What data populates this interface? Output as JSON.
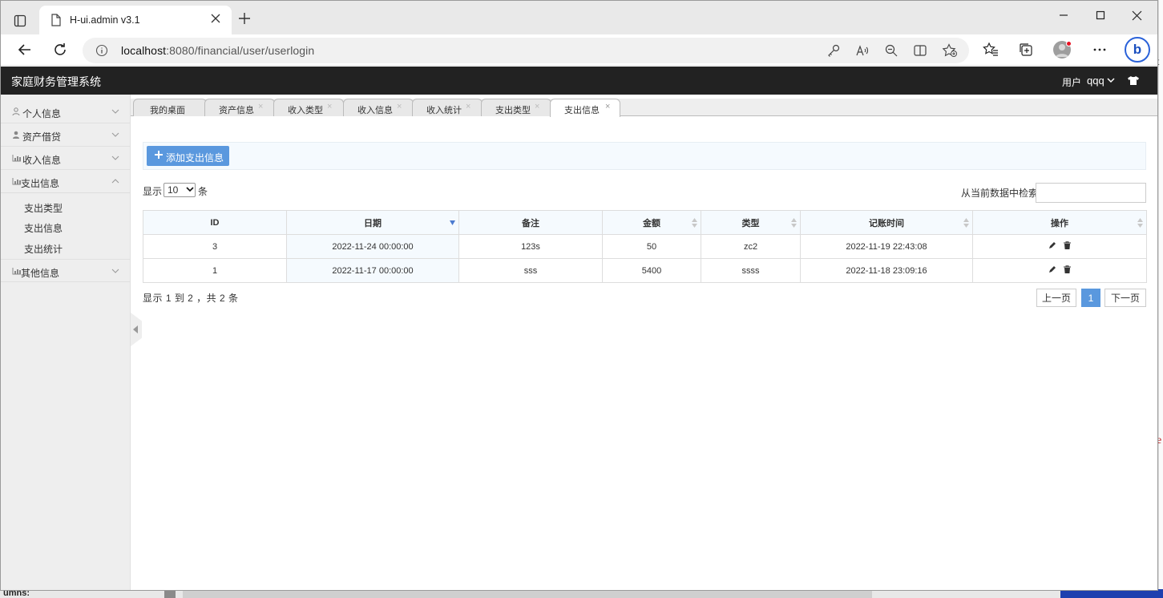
{
  "browser": {
    "tab_title": "H-ui.admin v3.1",
    "url_host": "localhost",
    "url_rest": ":8080/financial/user/userlogin"
  },
  "app": {
    "title": "家庭财务管理系统",
    "user_label": "用户",
    "user_name": "qqq"
  },
  "sidebar": {
    "menus": [
      {
        "label": "个人信息",
        "icon": "user-outline-icon"
      },
      {
        "label": "资产借贷",
        "icon": "user-icon"
      },
      {
        "label": "收入信息",
        "icon": "chart-icon"
      },
      {
        "label": "支出信息",
        "icon": "chart-icon"
      },
      {
        "label": "其他信息",
        "icon": "chart-icon"
      }
    ],
    "submenu": [
      "支出类型",
      "支出信息",
      "支出统计"
    ]
  },
  "tabs": [
    "我的桌面",
    "资产信息",
    "收入类型",
    "收入信息",
    "收入统计",
    "支出类型",
    "支出信息"
  ],
  "toolbar": {
    "add_label": "添加支出信息"
  },
  "table_controls": {
    "show_label": "显示",
    "page_length": "10",
    "suffix": "条",
    "search_label": "从当前数据中检索:"
  },
  "table": {
    "headers": [
      "ID",
      "日期",
      "备注",
      "金额",
      "类型",
      "记账时间",
      "操作"
    ],
    "rows": [
      [
        "3",
        "2022-11-24 00:00:00",
        "123s",
        "50",
        "zc2",
        "2022-11-19 22:43:08"
      ],
      [
        "1",
        "2022-11-17 00:00:00",
        "sss",
        "5400",
        "ssss",
        "2022-11-18 23:09:16"
      ]
    ]
  },
  "pagination": {
    "info": "显示 1 到 2 ，共 2 条",
    "prev": "上一页",
    "current": "1",
    "next": "下一页"
  },
  "background": {
    "bottom_text": "umns:",
    "edge_char_1": "t",
    "edge_char_2": "e"
  }
}
